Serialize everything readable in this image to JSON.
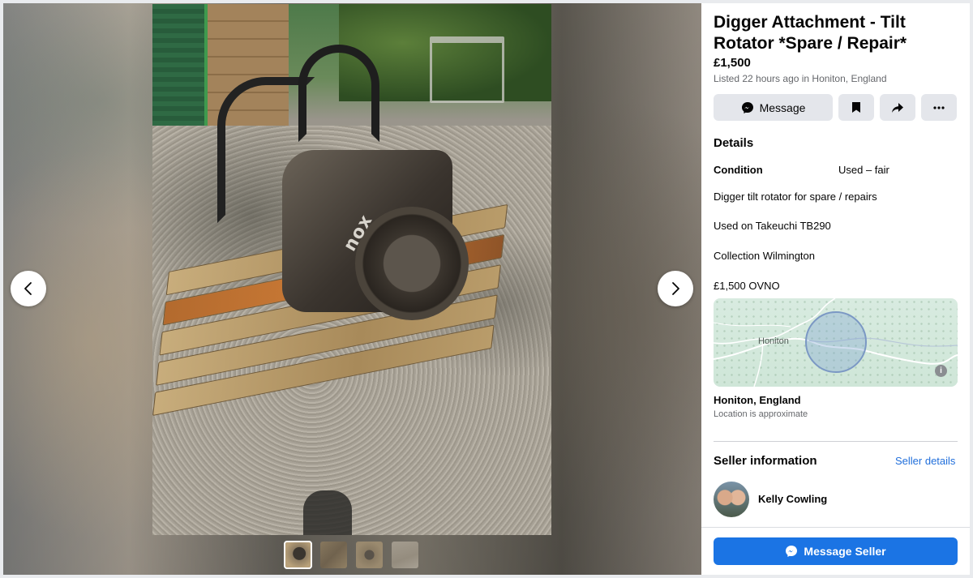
{
  "listing": {
    "title": "Digger Attachment - Tilt Rotator *Spare / Repair*",
    "price": "£1,500",
    "listed": "Listed 22 hours ago in Honiton, England"
  },
  "actions": {
    "message_label": "Message",
    "save_icon": "bookmark-icon",
    "share_icon": "share-icon",
    "more_icon": "more-icon"
  },
  "details": {
    "heading": "Details",
    "condition_label": "Condition",
    "condition_value": "Used – fair",
    "description": [
      "Digger tilt rotator for spare / repairs",
      "Used on Takeuchi TB290",
      "Collection Wilmington",
      "£1,500 OVNO"
    ]
  },
  "map": {
    "place_label": "Honiton",
    "info_icon": "info-icon"
  },
  "location": {
    "name": "Honiton, England",
    "note": "Location is approximate"
  },
  "seller": {
    "heading": "Seller information",
    "details_link": "Seller details",
    "name": "Kelly Cowling"
  },
  "cta": {
    "message_seller_label": "Message Seller"
  },
  "viewer": {
    "photo_logo_text": "nox",
    "prev_icon": "chevron-left-icon",
    "next_icon": "chevron-right-icon",
    "thumbnail_count": 4,
    "active_thumbnail": 1
  },
  "colors": {
    "primary_button": "#1b74e4",
    "link": "#216fdb",
    "secondary_button": "#e4e6eb",
    "muted_text": "#65676b"
  }
}
